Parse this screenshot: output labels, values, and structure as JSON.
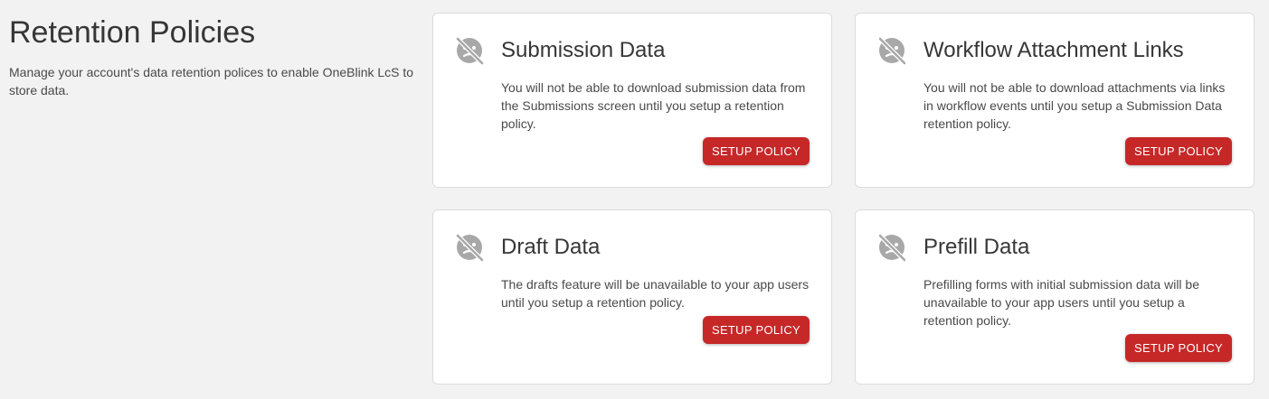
{
  "page": {
    "title": "Retention Policies",
    "description": "Manage your account's data retention polices to enable OneBlink LcS to store data."
  },
  "cards": [
    {
      "icon": "face-off-icon",
      "title": "Submission Data",
      "text": "You will not be able to download submission data from the Submissions screen until you setup a retention policy.",
      "button_label": "SETUP POLICY"
    },
    {
      "icon": "face-off-icon",
      "title": "Workflow Attachment Links",
      "text": "You will not be able to download attachments via links in workflow events until you setup a Submission Data retention policy.",
      "button_label": "SETUP POLICY"
    },
    {
      "icon": "face-off-icon",
      "title": "Draft Data",
      "text": "The drafts feature will be unavailable to your app users until you setup a retention policy.",
      "button_label": "SETUP POLICY"
    },
    {
      "icon": "face-off-icon",
      "title": "Prefill Data",
      "text": "Prefilling forms with initial submission data will be unavailable to your app users until you setup a retention policy.",
      "button_label": "SETUP POLICY"
    }
  ],
  "colors": {
    "background": "#f2f2f2",
    "card": "#ffffff",
    "button": "#c62828",
    "icon": "#a8a8a8"
  }
}
